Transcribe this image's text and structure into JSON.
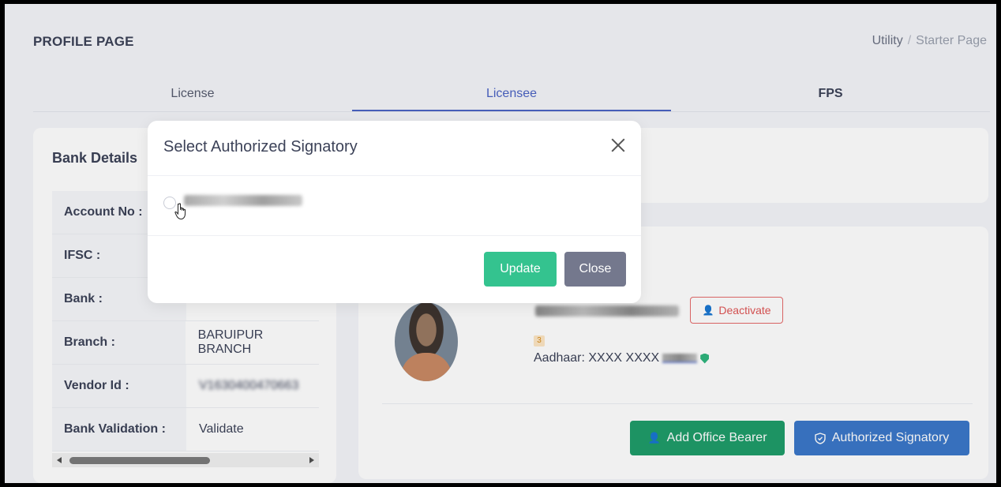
{
  "header": {
    "title": "PROFILE PAGE",
    "breadcrumb": {
      "parent": "Utility",
      "separator": "/",
      "current": "Starter Page"
    }
  },
  "tabs": [
    {
      "label": "License",
      "active": false
    },
    {
      "label": "Licensee",
      "active": true
    },
    {
      "label": "FPS",
      "active": false
    }
  ],
  "bank_details": {
    "title": "Bank Details",
    "rows": [
      {
        "key": "Account No :",
        "value": ""
      },
      {
        "key": "IFSC :",
        "value": ""
      },
      {
        "key": "Bank :",
        "value": ""
      },
      {
        "key": "Branch :",
        "value": "BARUIPUR BRANCH"
      },
      {
        "key": "Vendor Id :",
        "value": "V1630400470663"
      },
      {
        "key": "Bank Validation :",
        "value": "Validate"
      }
    ]
  },
  "licensee": {
    "deactivate_label": "Deactivate",
    "badge": "3",
    "aadhaar_label": "Aadhaar: XXXX XXXX",
    "add_office_bearer_label": "Add Office Bearer",
    "authorized_signatory_label": "Authorized Signatory"
  },
  "modal": {
    "title": "Select Authorized Signatory",
    "update_label": "Update",
    "close_label": "Close"
  },
  "colors": {
    "primary": "#4b63c4",
    "success": "#34c38f",
    "success_dark": "#1f9d6a",
    "info": "#3b78c9",
    "secondary": "#74788d",
    "danger": "#e05656"
  }
}
